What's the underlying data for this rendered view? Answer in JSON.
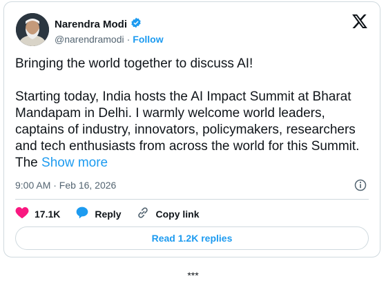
{
  "author": {
    "name": "Narendra Modi",
    "handle": "@narendramodi",
    "separator": "·",
    "follow_label": "Follow",
    "verified_color": "#1d9bf0"
  },
  "tweet": {
    "text": "Bringing the world together to discuss AI!\n\nStarting today, India hosts the AI Impact Summit at Bharat Mandapam in Delhi. I warmly welcome world leaders, captains of industry, innovators, policymakers, researchers and tech enthusiasts from across the world for this Summit. The ",
    "show_more": "Show more",
    "timestamp": "9:00 AM · Feb 16, 2026"
  },
  "actions": {
    "likes": "17.1K",
    "reply_label": "Reply",
    "copy_link_label": "Copy link"
  },
  "replies_button": "Read 1.2K replies",
  "footer": "***",
  "icons": [
    "x-logo-icon",
    "verified-badge-icon",
    "info-icon",
    "heart-icon",
    "reply-bubble-icon",
    "link-icon"
  ],
  "colors": {
    "accent": "#1d9bf0",
    "heart": "#f91880",
    "text": "#0f1419",
    "muted": "#536471"
  }
}
